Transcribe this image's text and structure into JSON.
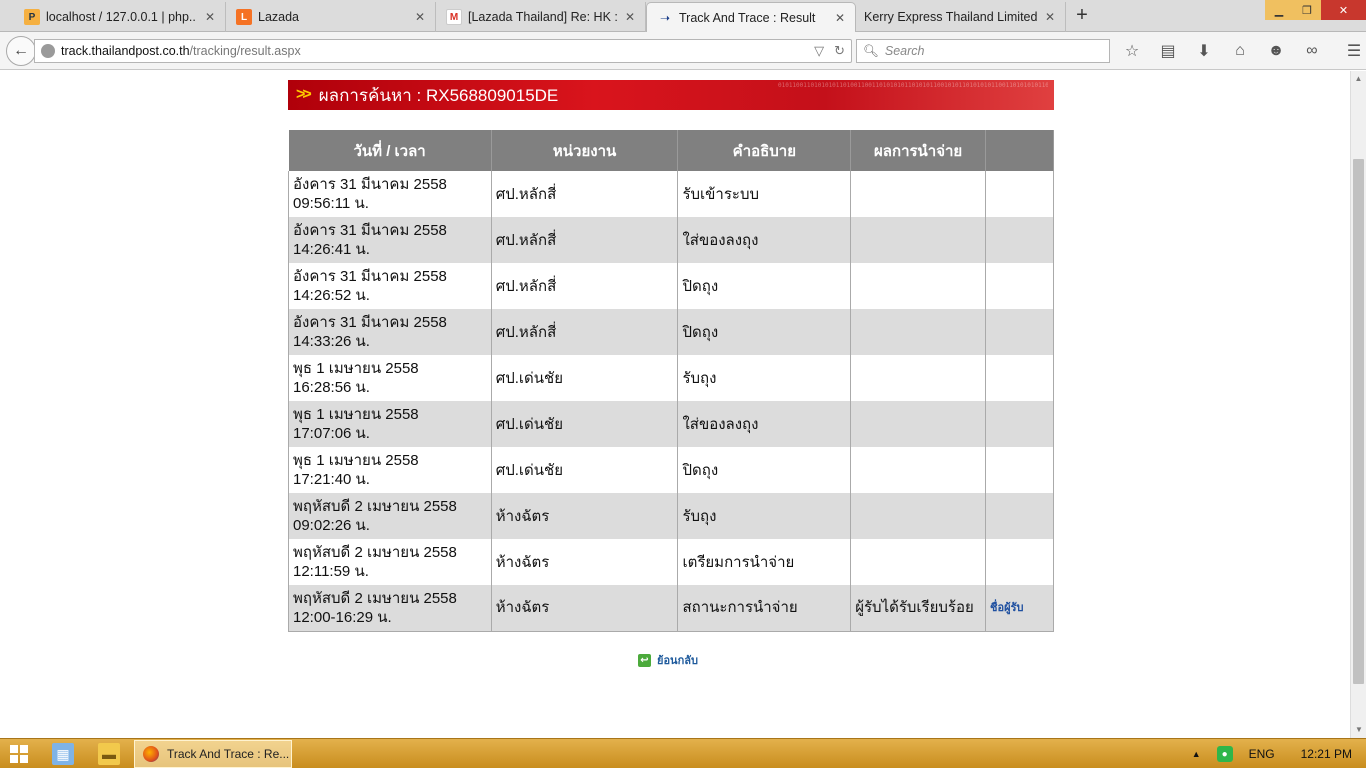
{
  "browser": {
    "tabs": [
      {
        "title": "localhost / 127.0.0.1 | php...",
        "icon": "phpmyadmin-icon",
        "active": false
      },
      {
        "title": "Lazada",
        "icon": "lazada-icon",
        "active": false
      },
      {
        "title": "[Lazada Thailand] Re: HK : ...",
        "icon": "gmail-icon",
        "active": false
      },
      {
        "title": "Track And Trace : Result",
        "icon": "thailandpost-icon",
        "active": true
      },
      {
        "title": "Kerry Express Thailand Limited ...",
        "icon": "blank-icon",
        "active": false
      }
    ],
    "url_host": "track.thailandpost.co.th",
    "url_path": "/tracking/result.aspx",
    "search_placeholder": "Search"
  },
  "page": {
    "banner_label": "ผลการค้นหา : RX568809015DE",
    "table": {
      "headers": [
        "วันที่ / เวลา",
        "หน่วยงาน",
        "คำอธิบาย",
        "ผลการนำจ่าย",
        ""
      ],
      "rows": [
        {
          "date": "อังคาร 31 มีนาคม 2558",
          "time": "09:56:11 น.",
          "office": "ศป.หลักสี่",
          "desc": "รับเข้าระบบ",
          "result": "",
          "link": ""
        },
        {
          "date": "อังคาร 31 มีนาคม 2558",
          "time": "14:26:41 น.",
          "office": "ศป.หลักสี่",
          "desc": "ใส่ของลงถุง",
          "result": "",
          "link": ""
        },
        {
          "date": "อังคาร 31 มีนาคม 2558",
          "time": "14:26:52 น.",
          "office": "ศป.หลักสี่",
          "desc": "ปิดถุง",
          "result": "",
          "link": ""
        },
        {
          "date": "อังคาร 31 มีนาคม 2558",
          "time": "14:33:26 น.",
          "office": "ศป.หลักสี่",
          "desc": "ปิดถุง",
          "result": "",
          "link": ""
        },
        {
          "date": "พุธ 1 เมษายน 2558",
          "time": "16:28:56 น.",
          "office": "ศป.เด่นชัย",
          "desc": "รับถุง",
          "result": "",
          "link": ""
        },
        {
          "date": "พุธ 1 เมษายน 2558",
          "time": "17:07:06 น.",
          "office": "ศป.เด่นชัย",
          "desc": "ใส่ของลงถุง",
          "result": "",
          "link": ""
        },
        {
          "date": "พุธ 1 เมษายน 2558",
          "time": "17:21:40 น.",
          "office": "ศป.เด่นชัย",
          "desc": "ปิดถุง",
          "result": "",
          "link": ""
        },
        {
          "date": "พฤหัสบดี 2 เมษายน 2558",
          "time": "09:02:26 น.",
          "office": "ห้างฉัตร",
          "desc": "รับถุง",
          "result": "",
          "link": ""
        },
        {
          "date": "พฤหัสบดี 2 เมษายน 2558",
          "time": "12:11:59 น.",
          "office": "ห้างฉัตร",
          "desc": "เตรียมการนำจ่าย",
          "result": "",
          "link": ""
        },
        {
          "date": "พฤหัสบดี 2 เมษายน 2558",
          "time": "12:00-16:29 น.",
          "office": "ห้างฉัตร",
          "desc": "สถานะการนำจ่าย",
          "result": "ผู้รับได้รับเรียบร้อย",
          "link": "ชื่อผู้รับ"
        }
      ]
    },
    "back_label": "ย้อนกลับ"
  },
  "taskbar": {
    "app_title": "Track And Trace : Re...",
    "lang": "ENG",
    "clock": "12:21 PM"
  }
}
